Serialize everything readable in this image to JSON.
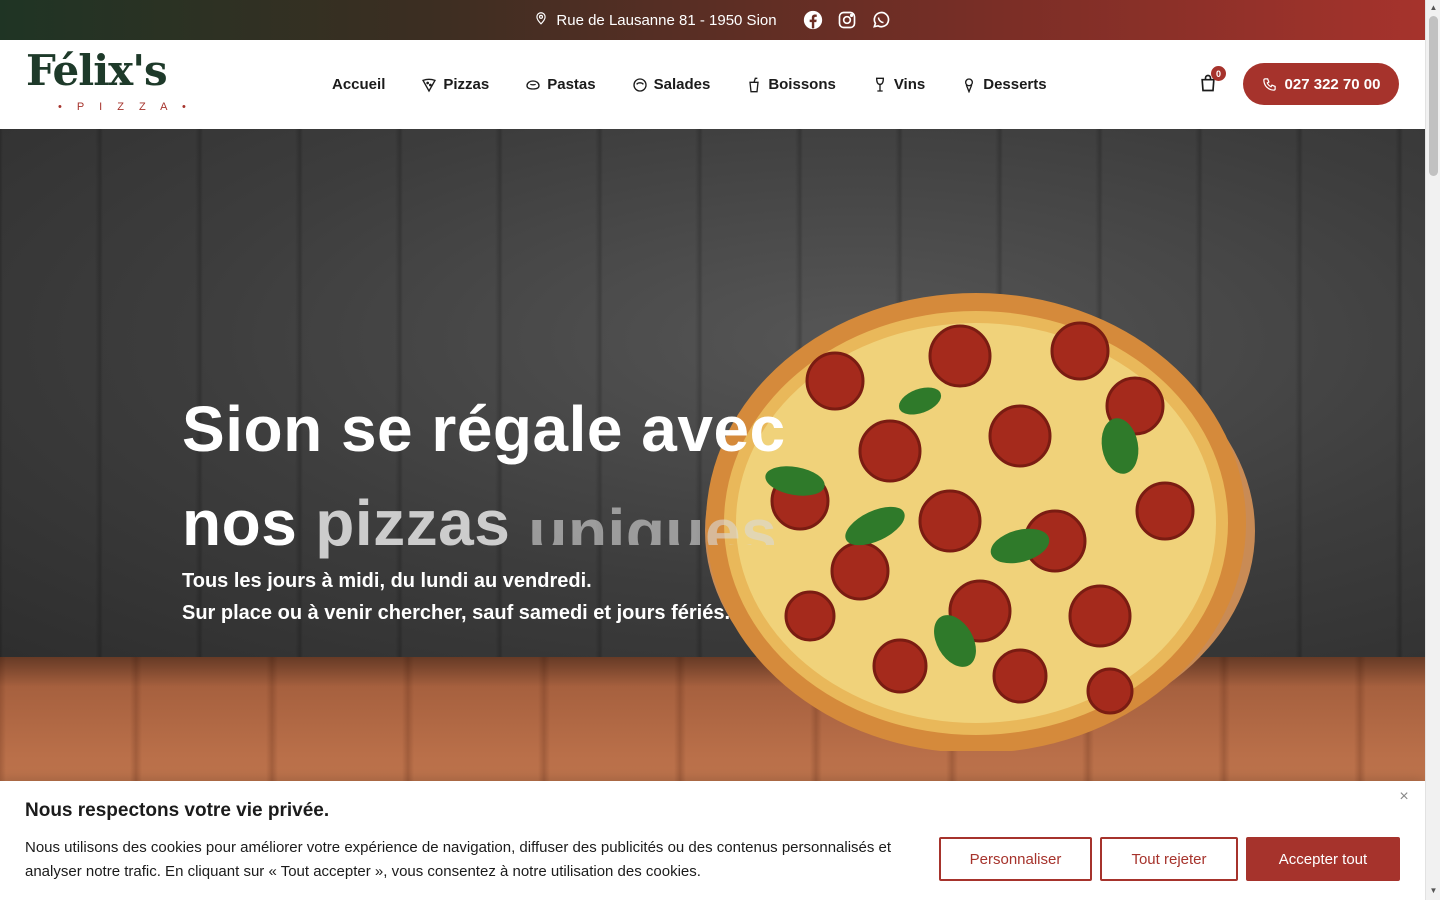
{
  "topbar": {
    "address": "Rue de Lausanne 81 - 1950 Sion",
    "social": [
      "facebook-icon",
      "instagram-icon",
      "whatsapp-icon"
    ]
  },
  "header": {
    "logo": {
      "word": "Félix's",
      "sub": "• P I Z Z A •"
    },
    "nav": [
      {
        "label": "Accueil",
        "icon": ""
      },
      {
        "label": "Pizzas",
        "icon": "pizza-slice-icon"
      },
      {
        "label": "Pastas",
        "icon": "pasta-icon"
      },
      {
        "label": "Salades",
        "icon": "salad-bowl-icon"
      },
      {
        "label": "Boissons",
        "icon": "drink-cup-icon"
      },
      {
        "label": "Vins",
        "icon": "wine-glass-icon"
      },
      {
        "label": "Desserts",
        "icon": "ice-cream-icon"
      }
    ],
    "cart_count": "0",
    "phone": "027 322 70 00"
  },
  "hero": {
    "line1": "Sion se régale avec",
    "line2_word": "nos",
    "rotating_word": "pizzas",
    "rotating_next": "uniques",
    "sub1": "Tous les jours à midi, du lundi au vendredi.",
    "sub2": "Sur place ou à venir chercher, sauf samedi et jours fériés."
  },
  "cookie": {
    "title": "Nous respectons votre vie privée.",
    "text": "Nous utilisons des cookies pour améliorer votre expérience de navigation, diffuser des publicités ou des contenus personnalisés et analyser notre trafic. En cliquant sur « Tout accepter », vous consentez à notre utilisation des cookies.",
    "customize": "Personnaliser",
    "reject": "Tout rejeter",
    "accept": "Accepter tout",
    "close": "×"
  },
  "colors": {
    "brand_red": "#a6332c",
    "brand_green": "#1e3a2a"
  }
}
